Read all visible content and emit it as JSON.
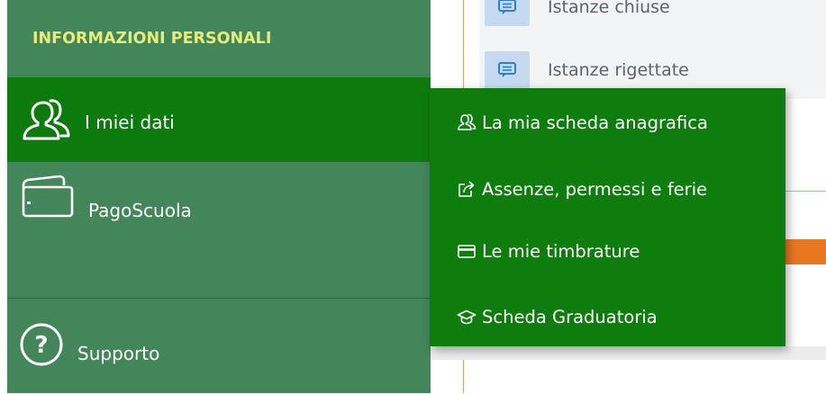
{
  "background": {
    "items": [
      {
        "label": "Istanze chiuse",
        "icon": "comment-icon"
      },
      {
        "label": "Istanze rigettate",
        "icon": "comment-icon"
      }
    ]
  },
  "sidebar": {
    "header": "INFORMAZIONI PERSONALI",
    "items": [
      {
        "label": "I miei dati",
        "icon": "users-icon",
        "active": true
      },
      {
        "label": "PagoScuola",
        "icon": "wallet-icon"
      },
      {
        "label": "Supporto",
        "icon": "help-circle-icon"
      }
    ]
  },
  "submenu": {
    "items": [
      {
        "label": "La mia scheda anagrafica",
        "icon": "users-icon"
      },
      {
        "label": "Assenze, permessi e ferie",
        "icon": "share-edit-icon"
      },
      {
        "label": "Le mie timbrature",
        "icon": "credit-card-icon"
      },
      {
        "label": "Scheda Graduatoria",
        "icon": "graduation-cap-icon"
      }
    ]
  },
  "colors": {
    "sidebar_bg": "#43865a",
    "active_bg": "#0d7a0d",
    "submenu_bg": "#0e7d0e",
    "header_text": "#e7ec7b",
    "accent_orange": "#e87722"
  }
}
